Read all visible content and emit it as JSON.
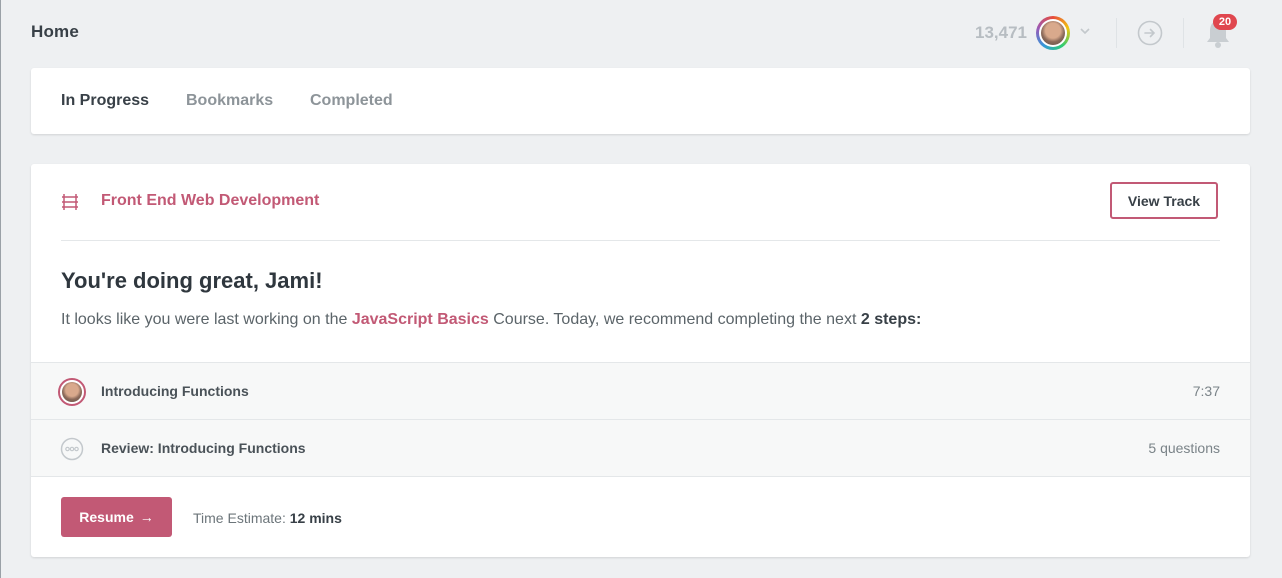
{
  "header": {
    "title": "Home",
    "points": "13,471",
    "notifications_count": "20"
  },
  "tabs": [
    {
      "label": "In Progress",
      "active": true
    },
    {
      "label": "Bookmarks",
      "active": false
    },
    {
      "label": "Completed",
      "active": false
    }
  ],
  "track": {
    "name": "Front End Web Development",
    "view_button": "View Track",
    "icon": "track-icon"
  },
  "progress": {
    "greeting": "You're doing great, Jami!",
    "rec_prefix": "It looks like you were last working on the ",
    "course_link": "JavaScript Basics",
    "rec_middle": " Course. Today, we recommend completing the next ",
    "rec_strong": "2 steps:"
  },
  "steps": [
    {
      "title": "Introducing Functions",
      "meta": "7:37",
      "icon": "video-avatar-icon"
    },
    {
      "title": "Review: Introducing Functions",
      "meta": "5 questions",
      "icon": "quiz-dots-icon"
    }
  ],
  "footer": {
    "resume_label": "Resume",
    "estimate_label": "Time Estimate: ",
    "estimate_value": "12 mins"
  },
  "colors": {
    "accent": "#c25975",
    "background": "#eef0f2",
    "badge": "#e0474f"
  }
}
